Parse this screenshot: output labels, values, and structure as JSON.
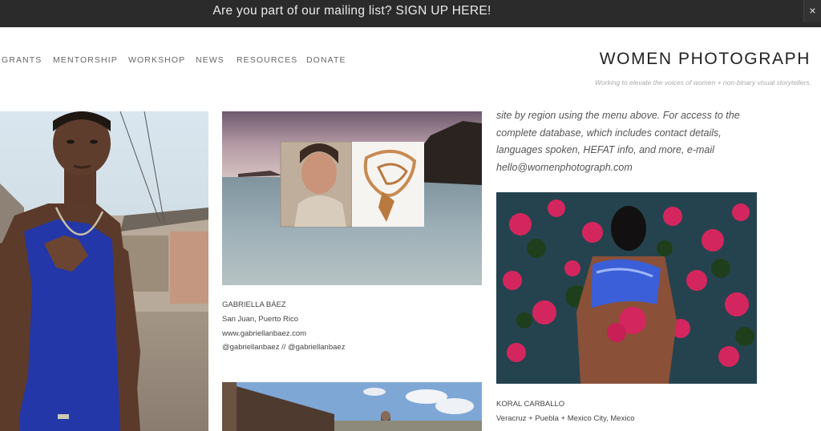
{
  "banner": {
    "text": "Are you part of our mailing list? SIGN UP HERE!",
    "close": "×"
  },
  "nav": {
    "items": [
      "GRANTS",
      "MENTORSHIP",
      "WORKSHOP",
      "NEWS",
      "RESOURCES",
      "DONATE"
    ]
  },
  "site": {
    "logo": "WOMEN PHOTOGRAPH",
    "tagline": "Working to elevate the voices of women + non-binary visual storytellers."
  },
  "intro": {
    "lines": [
      "site by region using the menu above. For access to the",
      "complete database, which includes contact details,",
      "languages spoken, HEFAT info, and more, e-mail",
      "hello@womenphotograph.com"
    ]
  },
  "photographers": [
    {
      "name": "GABRIELLA BÁEZ",
      "location": "San Juan, Puerto Rico",
      "website": "www.gabriellanbaez.com",
      "social": "@gabriellanbaez // @gabriellanbaez"
    },
    {
      "name": "KORAL CARBALLO",
      "location": "Veracruz + Puebla + Mexico City, Mexico"
    }
  ]
}
